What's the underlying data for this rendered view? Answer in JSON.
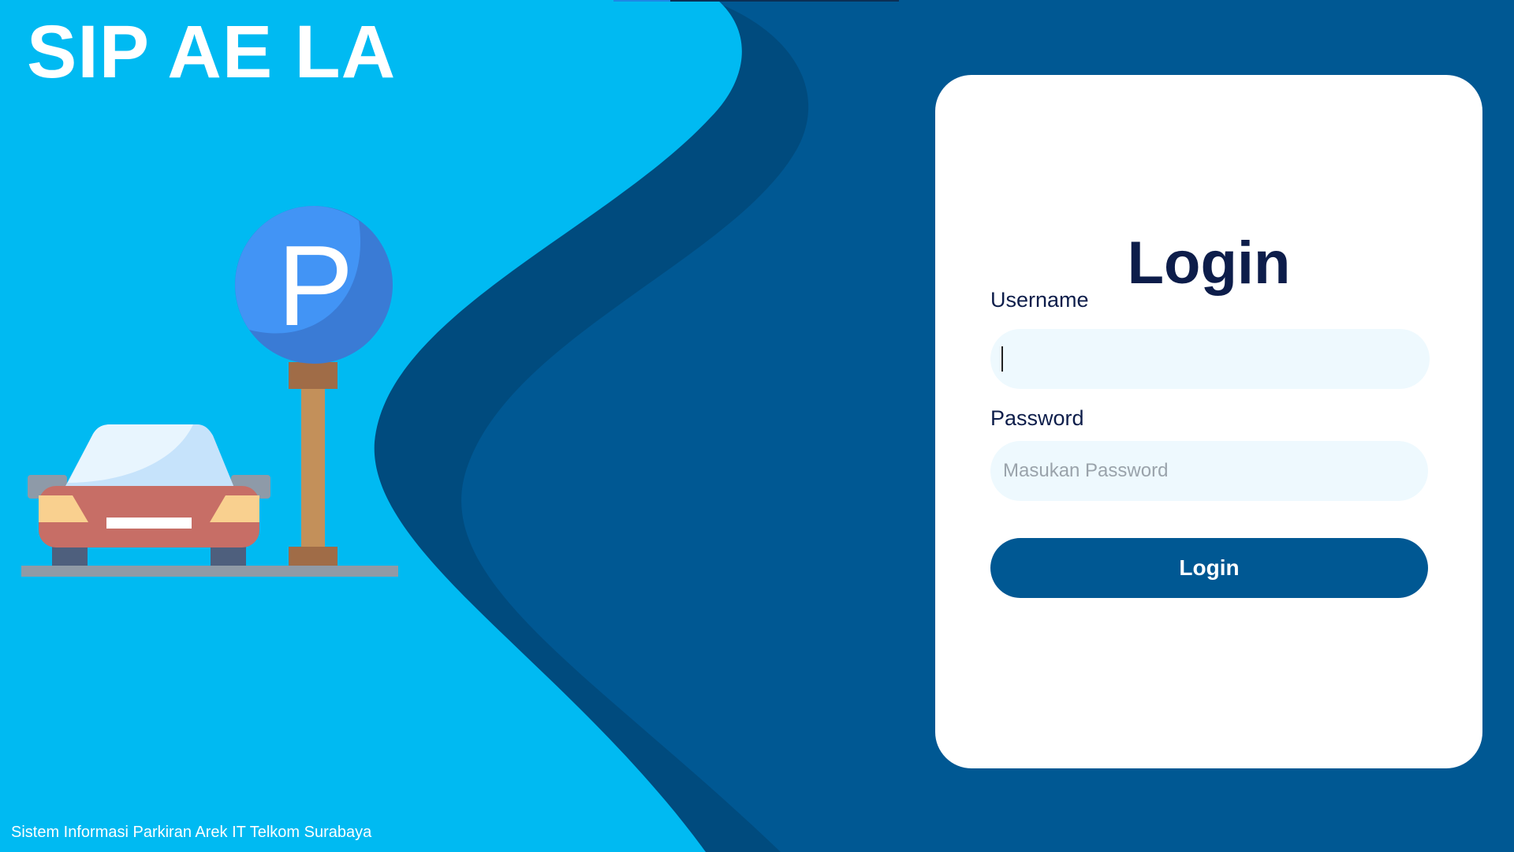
{
  "brand": {
    "title": "SIP AE LA",
    "tagline": "Sistem Informasi Parkiran Arek IT Telkom Surabaya"
  },
  "illustration": {
    "sign_letter": "P"
  },
  "login": {
    "heading": "Login",
    "username_label": "Username",
    "username_value": "",
    "password_label": "Password",
    "password_placeholder": "Masukan Password",
    "button_label": "Login"
  },
  "colors": {
    "light_blue": "#00BAF2",
    "dark_blue": "#005893",
    "wave_shadow": "#004B7E",
    "heading_navy": "#0D1D4A",
    "input_bg": "#EEF9FE"
  }
}
